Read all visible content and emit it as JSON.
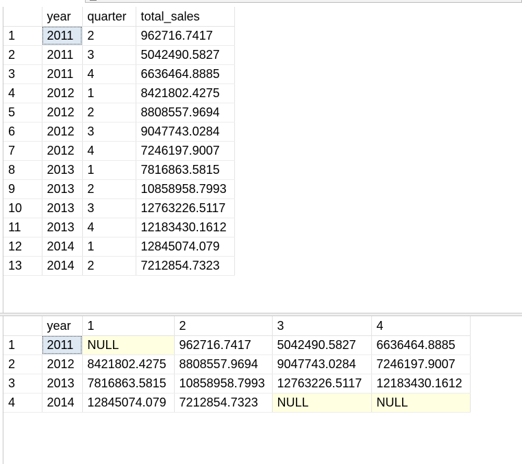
{
  "result1": {
    "columns": [
      "",
      "year",
      "quarter",
      "total_sales"
    ],
    "rows": [
      [
        "1",
        "2011",
        "2",
        "962716.7417"
      ],
      [
        "2",
        "2011",
        "3",
        "5042490.5827"
      ],
      [
        "3",
        "2011",
        "4",
        "6636464.8885"
      ],
      [
        "4",
        "2012",
        "1",
        "8421802.4275"
      ],
      [
        "5",
        "2012",
        "2",
        "8808557.9694"
      ],
      [
        "6",
        "2012",
        "3",
        "9047743.0284"
      ],
      [
        "7",
        "2012",
        "4",
        "7246197.9007"
      ],
      [
        "8",
        "2013",
        "1",
        "7816863.5815"
      ],
      [
        "9",
        "2013",
        "2",
        "10858958.7993"
      ],
      [
        "10",
        "2013",
        "3",
        "12763226.5117"
      ],
      [
        "11",
        "2013",
        "4",
        "12183430.1612"
      ],
      [
        "12",
        "2014",
        "1",
        "12845074.079"
      ],
      [
        "13",
        "2014",
        "2",
        "7212854.7323"
      ]
    ]
  },
  "result2": {
    "columns": [
      "",
      "year",
      "1",
      "2",
      "3",
      "4"
    ],
    "rows": [
      [
        "1",
        "2011",
        "NULL",
        "962716.7417",
        "5042490.5827",
        "6636464.8885"
      ],
      [
        "2",
        "2012",
        "8421802.4275",
        "8808557.9694",
        "9047743.0284",
        "7246197.9007"
      ],
      [
        "3",
        "2013",
        "7816863.5815",
        "10858958.7993",
        "12763226.5117",
        "12183430.1612"
      ],
      [
        "4",
        "2014",
        "12845074.079",
        "7212854.7323",
        "NULL",
        "NULL"
      ]
    ],
    "null_text": "NULL"
  },
  "colors": {
    "null_highlight": "#ffffe1",
    "selected_cell": "#dde8f3",
    "grid_line": "#e3e3e3"
  }
}
